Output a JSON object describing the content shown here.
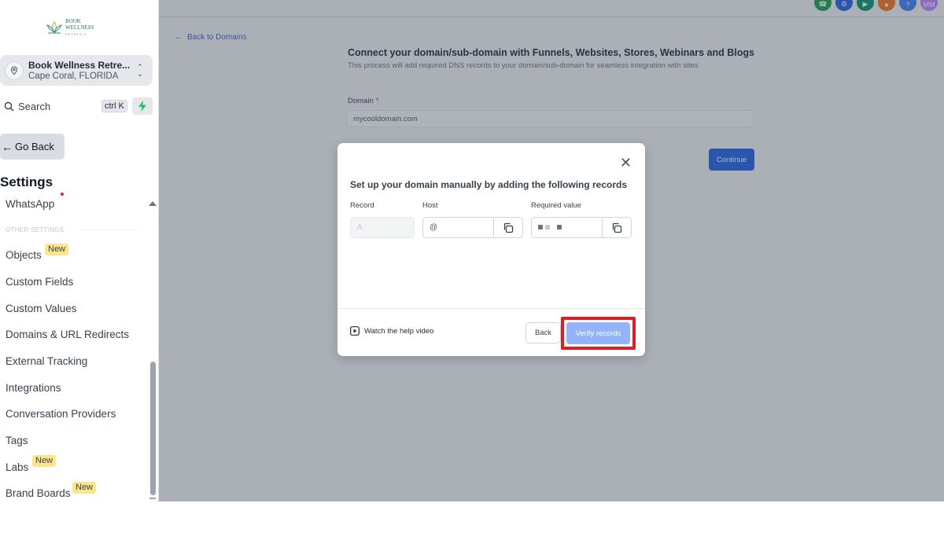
{
  "sidebar": {
    "logo": {
      "name": "BOOK WELLNESS",
      "tagline": "RETREATS"
    },
    "account": {
      "name": "Book Wellness Retre...",
      "location": "Cape Coral, FLORIDA"
    },
    "search": {
      "label": "Search",
      "shortcut": "ctrl K"
    },
    "go_back": "Go Back",
    "title": "Settings",
    "whatsapp": "WhatsApp",
    "section_label": "OTHER SETTINGS",
    "items": [
      {
        "label": "Objects",
        "badge": "New"
      },
      {
        "label": "Custom Fields"
      },
      {
        "label": "Custom Values"
      },
      {
        "label": "Domains & URL Redirects"
      },
      {
        "label": "External Tracking"
      },
      {
        "label": "Integrations"
      },
      {
        "label": "Conversation Providers"
      },
      {
        "label": "Tags"
      },
      {
        "label": "Labs",
        "badge": "New"
      },
      {
        "label": "Brand Boards",
        "badge": "New"
      }
    ]
  },
  "topbar": {
    "icons": [
      {
        "name": "phone-icon",
        "color": "#16a34a"
      },
      {
        "name": "support-icon",
        "color": "#2563eb"
      },
      {
        "name": "megaphone-icon",
        "color": "#059669"
      },
      {
        "name": "bell-icon",
        "color": "#f97316"
      },
      {
        "name": "help-icon",
        "color": "#3b82f6"
      }
    ],
    "user_initials": "MM",
    "user_color": "#c084fc"
  },
  "page": {
    "back_link": "Back to Domains",
    "title": "Connect your domain/sub-domain with Funnels, Websites, Stores, Webinars and Blogs",
    "subtitle": "This process will add required DNS records to your domain/sub-domain for seamless integration with sites",
    "domain_label": "Domain",
    "domain_required": "*",
    "domain_value": "mycooldomain.com",
    "continue": "Continue"
  },
  "modal": {
    "title": "Set up your domain manually by adding the following records",
    "columns": {
      "record": "Record",
      "host": "Host",
      "required_value": "Required value"
    },
    "record_value": "A",
    "host_value": "@",
    "help_video": "Watch the help video",
    "back": "Back",
    "verify": "Verify records"
  },
  "colors": {
    "accent": "#2563eb",
    "verify_disabled": "#93b3fb",
    "highlight": "#e11d24",
    "badge": "#fde68a"
  }
}
